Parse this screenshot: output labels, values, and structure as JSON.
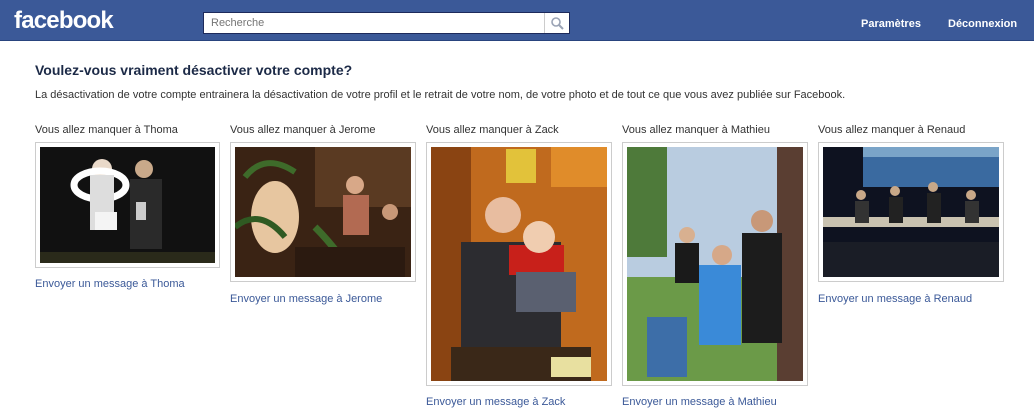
{
  "header": {
    "logo": "facebook",
    "search_placeholder": "Recherche",
    "nav": [
      "Paramètres",
      "Déconnexion"
    ]
  },
  "page": {
    "title": "Voulez-vous vraiment désactiver votre compte?",
    "description": "La désactivation de votre compte entrainera la désactivation de votre profil et le retrait de votre nom, de votre photo et de tout ce que vous avez publiée sur Facebook."
  },
  "friends": [
    {
      "miss_label": "Vous allez manquer à Thoma",
      "message_link": "Envoyer un message à Thoma"
    },
    {
      "miss_label": "Vous allez manquer à Jerome",
      "message_link": "Envoyer un message à Jerome"
    },
    {
      "miss_label": "Vous allez manquer à Zack",
      "message_link": "Envoyer un message à Zack"
    },
    {
      "miss_label": "Vous allez manquer à Mathieu",
      "message_link": "Envoyer un message à Mathieu"
    },
    {
      "miss_label": "Vous allez manquer à Renaud",
      "message_link": "Envoyer un message à Renaud"
    }
  ],
  "colors": {
    "brand": "#3b5998",
    "link": "#3b5998"
  }
}
